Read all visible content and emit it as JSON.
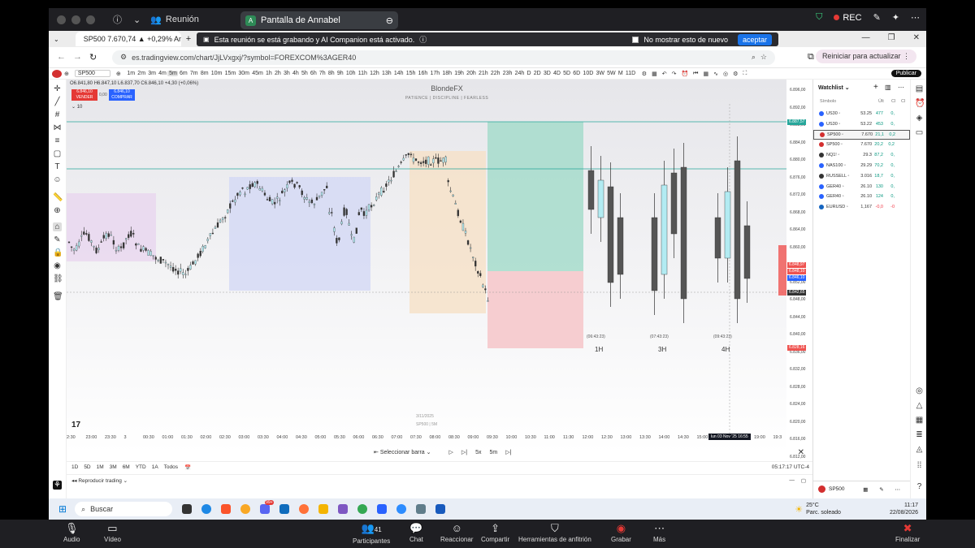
{
  "zoom_top": {
    "meeting_label": "Reunión",
    "share_title": "Pantalla de Annabel",
    "share_initial": "A",
    "rec_label": "REC"
  },
  "browser": {
    "tab_title": "SP500 7.670,74 ▲ +0,29% Anna",
    "banner_text": "Esta reunión se está grabando y AI Companion está activado.",
    "banner_checkbox": "No mostrar esto de nuevo",
    "banner_accept": "aceptar",
    "url": "es.tradingview.com/chart/JjLVxgxj/?symbol=FOREXCOM%3AGER40",
    "reload_label": "Reiniciar para actualizar",
    "profile_initial": "A"
  },
  "tv": {
    "symbol": "SP500",
    "intervals": [
      "1m",
      "2m",
      "3m",
      "4m",
      "5m",
      "6m",
      "7m",
      "8m",
      "10m",
      "15m",
      "30m",
      "45m",
      "1h",
      "2h",
      "3h",
      "4h",
      "5h",
      "6h",
      "7h",
      "8h",
      "9h",
      "10h",
      "11h",
      "12h",
      "13h",
      "14h",
      "15h",
      "16h",
      "17h",
      "18h",
      "19h",
      "20h",
      "21h",
      "22h",
      "23h",
      "24h",
      "D",
      "2D",
      "3D",
      "4D",
      "5D",
      "6D",
      "10D",
      "3W",
      "5W",
      "M",
      "11D"
    ],
    "publish_label": "Publicar",
    "ohlc": "O6.841,80 H6.847,10 L6.837,70 C6.846,10 +4,30 (+0,06%)",
    "sell_price": "6.846,10",
    "sell_label": "VENDER",
    "buy_price": "6.846,10",
    "buy_label": "COMPRAR",
    "spread": "0,00",
    "volume": "10",
    "chart_title": "BlondeFX",
    "chart_subtitle": "PATIENCE | DISCIPLINE | FEARLESS",
    "watermark_date": "3/11/2025",
    "watermark_sym": "SP500 | 5M",
    "htf_labels": [
      "1H",
      "3H",
      "4H"
    ],
    "htf_timers": [
      "(06:43:23)",
      "(07:43:23)",
      "(09:43:23)"
    ],
    "time_ticks": [
      "2:30",
      "23:00",
      "23:30",
      "3",
      "00:30",
      "01:00",
      "01:30",
      "02:00",
      "02:30",
      "03:00",
      "03:30",
      "04:00",
      "04:30",
      "05:00",
      "05:30",
      "06:00",
      "06:30",
      "07:00",
      "07:30",
      "08:00",
      "08:30",
      "09:00",
      "09:30",
      "10:00",
      "10:30",
      "11:00",
      "11:30",
      "12:00",
      "12:30",
      "13:00",
      "13:30",
      "14:00",
      "14:30",
      "15:00",
      "15:30",
      "16:00",
      "19:00",
      "19:3"
    ],
    "time_cursor": "lun 03 Nov '25  16:55",
    "price_ticks": [
      "6.896,00",
      "6.892,00",
      "6.888,00",
      "6.884,00",
      "6.880,00",
      "6.876,00",
      "6.872,00",
      "6.868,00",
      "6.864,00",
      "6.860,00",
      "6.856,00",
      "6.852,00",
      "6.848,00",
      "6.844,00",
      "6.840,00",
      "6.836,00",
      "6.832,00",
      "6.828,00",
      "6.824,00",
      "6.820,00",
      "6.816,00",
      "6.812,00"
    ],
    "price_tags": {
      "tp": "6.887,57",
      "p1": "6.848,97",
      "p2": "6.848,10",
      "p3": "6.846,10",
      "cur": "6.842,65",
      "sl": "6.828,16"
    },
    "replay": {
      "select_bar": "Seleccionar barra",
      "speed": "5x",
      "tf": "5m"
    },
    "ranges": [
      "1D",
      "5D",
      "1M",
      "3M",
      "6M",
      "YTD",
      "1A",
      "Todos"
    ],
    "clock": "05:17:17 UTC-4",
    "trading_label": "Reproducir trading"
  },
  "watchlist": {
    "title": "Watchlist",
    "col_symbol": "Símbolo",
    "col_last": "Últ",
    "col_chg": "Cl",
    "col_chgp": "Cl",
    "rows": [
      {
        "sym": "US30",
        "last": "53.25",
        "chg": "477",
        "chgp": "0,",
        "color": "#2962ff"
      },
      {
        "sym": "US30",
        "last": "53.22",
        "chg": "453",
        "chgp": "0,",
        "color": "#2962ff"
      },
      {
        "sym": "SP500",
        "last": "7.670",
        "chg": "21,1",
        "chgp": "0,2",
        "color": "#d32f2f"
      },
      {
        "sym": "SP500",
        "last": "7.670",
        "chg": "20,2",
        "chgp": "0,2",
        "color": "#d32f2f"
      },
      {
        "sym": "NQ1!",
        "last": "29.3\t",
        "chg": "87,2",
        "chgp": "0,",
        "color": "#333"
      },
      {
        "sym": "NAS100",
        "last": "29.29",
        "chg": "70,2",
        "chgp": "0,",
        "color": "#2962ff"
      },
      {
        "sym": "RUSSELL",
        "last": "3.016",
        "chg": "18,7",
        "chgp": "0,",
        "color": "#333"
      },
      {
        "sym": "GER40",
        "last": "26.10",
        "chg": "130",
        "chgp": "0,",
        "color": "#2962ff"
      },
      {
        "sym": "GER40",
        "last": "26.10",
        "chg": "124",
        "chgp": "0,",
        "color": "#2962ff"
      },
      {
        "sym": "EURUSD",
        "last": "1,167",
        "chg": "-0,0",
        "chgp": "-0",
        "color": "#1565c0"
      }
    ],
    "bottom_symbol": "SP500"
  },
  "taskbar": {
    "search": "Buscar",
    "weather_temp": "25°C",
    "weather_desc": "Parc. soleado",
    "time": "11:17",
    "date": "22/08/2026",
    "badge": "99+"
  },
  "zoom_bottom": {
    "audio": "Audio",
    "video": "Vídeo",
    "participants": "Participantes",
    "participants_count": "41",
    "chat": "Chat",
    "react": "Reaccionar",
    "share": "Compartir",
    "host_tools": "Herramientas de anfitrión",
    "record": "Grabar",
    "more": "Más",
    "end": "Finalizar"
  }
}
